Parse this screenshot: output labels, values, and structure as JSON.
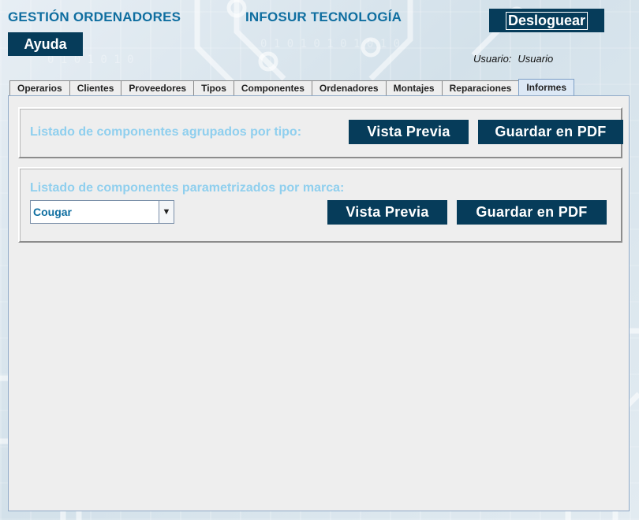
{
  "header": {
    "app_title": "GESTIÓN ORDENADORES",
    "company": "INFOSUR TECNOLOGÍA",
    "help_button": "Ayuda",
    "logout_button": "Desloguear",
    "user_label": "Usuario:",
    "user_name": "Usuario"
  },
  "tabs": [
    {
      "label": "Operarios",
      "active": false
    },
    {
      "label": "Clientes",
      "active": false
    },
    {
      "label": "Proveedores",
      "active": false
    },
    {
      "label": "Tipos",
      "active": false
    },
    {
      "label": "Componentes",
      "active": false
    },
    {
      "label": "Ordenadores",
      "active": false
    },
    {
      "label": "Montajes",
      "active": false
    },
    {
      "label": "Reparaciones",
      "active": false
    },
    {
      "label": "Informes",
      "active": true
    }
  ],
  "report_by_type": {
    "label": "Listado de componentes agrupados por tipo:",
    "preview_button": "Vista Previa",
    "pdf_button": "Guardar en PDF"
  },
  "report_by_brand": {
    "label": "Listado de componentes parametrizados por marca:",
    "brand_select_value": "Cougar",
    "preview_button": "Vista Previa",
    "pdf_button": "Guardar en PDF"
  },
  "colors": {
    "title_blue": "#0f6ea0",
    "button_dark": "#063c5a",
    "label_light_blue": "#8fcfee",
    "panel_bg": "#eeeeee"
  }
}
